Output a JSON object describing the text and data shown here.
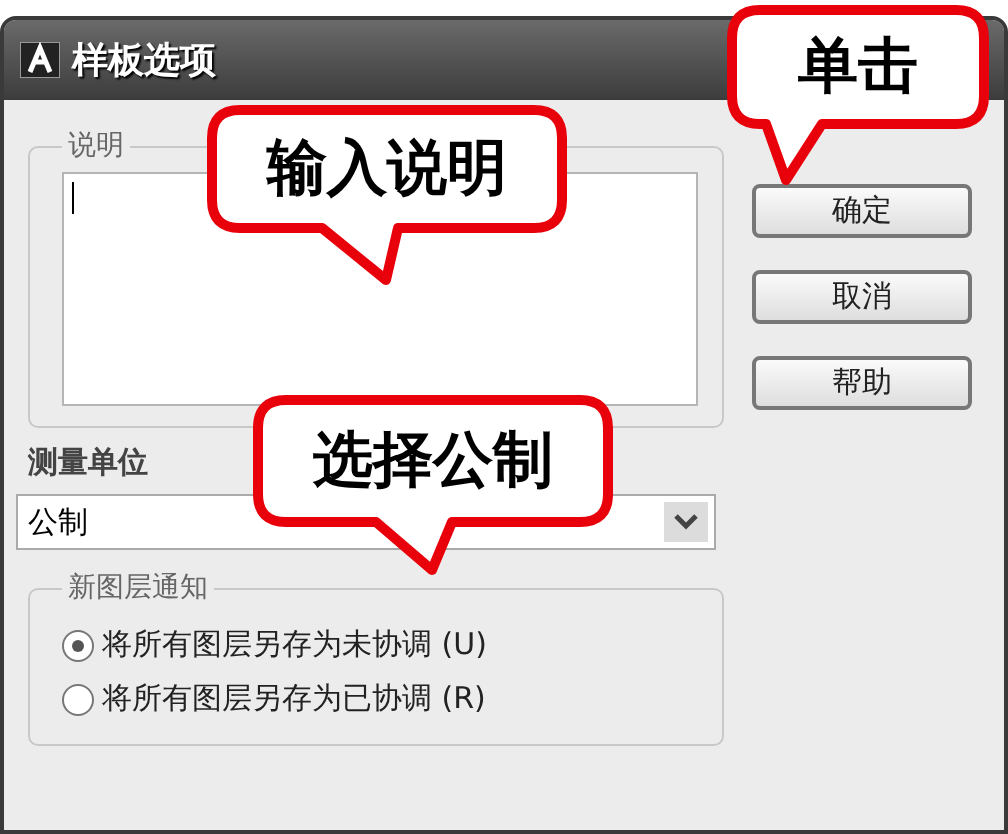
{
  "window": {
    "title": "样板选项"
  },
  "description": {
    "label": "说明"
  },
  "buttons": [
    "确定",
    "取消",
    "帮助"
  ],
  "units": {
    "label": "测量单位",
    "value": "公制"
  },
  "notification": {
    "label": "新图层通知",
    "options": [
      {
        "label": "将所有图层另存为未协调 (U)",
        "selected": true
      },
      {
        "label": "将所有图层另存为已协调 (R)",
        "selected": false
      }
    ]
  },
  "callouts": [
    {
      "text": "单击"
    },
    {
      "text": "输入说明"
    },
    {
      "text": "选择公制"
    }
  ]
}
